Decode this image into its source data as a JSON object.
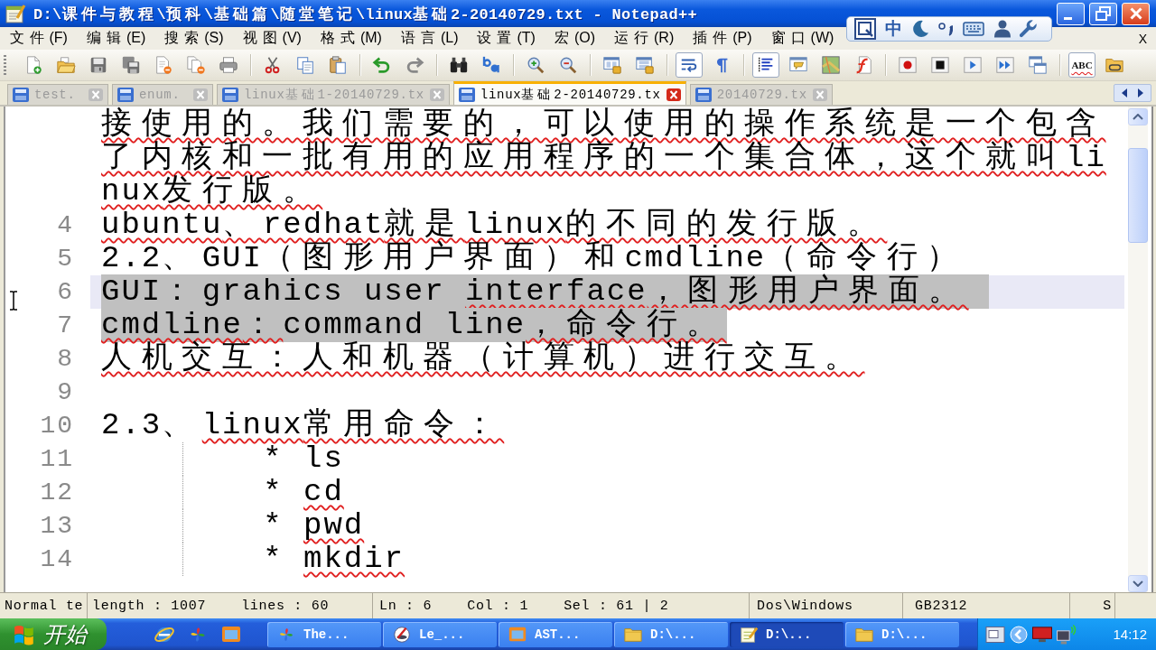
{
  "window": {
    "title": "D:\\课件与教程\\预科\\基础篇\\随堂笔记\\linux基础2-20140729.txt - Notepad++"
  },
  "menu": [
    "文件(F)",
    "编辑(E)",
    "搜索(S)",
    "视图(V)",
    "格式(M)",
    "语言(L)",
    "设置(T)",
    "宏(O)",
    "运行(R)",
    "插件(P)",
    "窗口(W)"
  ],
  "close_document": "X",
  "input_method_bar": {
    "mode": "中"
  },
  "toolbar": {
    "word_wrap": {
      "pressed": true
    },
    "show_all_characters": {
      "pressed": false
    },
    "indent_guide": {
      "pressed": true
    },
    "spell_check": {
      "label": "ABC",
      "pressed": true
    }
  },
  "tabs": [
    {
      "label": "test.",
      "selected": false
    },
    {
      "label": "enum.",
      "selected": false
    },
    {
      "label": "linux基础1-20140729.tx",
      "selected": false
    },
    {
      "label": "linux基础2-20140729.tx",
      "selected": true
    },
    {
      "label": "20140729.tx",
      "selected": false
    }
  ],
  "editor": {
    "lines": [
      {
        "selected": false,
        "current": false,
        "rows": [
          [
            {
              "text": "接使用的。我们需要的，可以使用的操作系统是一个包含",
              "misspelled": true
            }
          ],
          [
            {
              "text": "了内核和一批有用的应用程序的一个集合体，这个就叫li",
              "misspelled": true
            }
          ],
          [
            {
              "text": "nux发行版。",
              "misspelled": true
            }
          ]
        ]
      },
      {
        "number": "4",
        "selected": false,
        "current": false,
        "rows": [
          [
            {
              "text": "ubuntu、redhat就是linux的不同的发行版。",
              "misspelled": true
            }
          ]
        ]
      },
      {
        "number": "5",
        "selected": false,
        "current": false,
        "rows": [
          [
            {
              "text": "2.2、GUI（图形用户界面）和cmdline（命令行）",
              "misspelled": false
            }
          ]
        ]
      },
      {
        "number": "6",
        "selected": true,
        "current": true,
        "rows": [
          [
            {
              "text": "GUI：grahics user ",
              "misspelled": false
            },
            {
              "text": "interface，图形用户界面。",
              "misspelled": true
            }
          ]
        ]
      },
      {
        "number": "7",
        "selected": true,
        "current": false,
        "rows": [
          [
            {
              "text": "cmdline：",
              "misspelled": true
            },
            {
              "text": "command line",
              "misspelled": false
            },
            {
              "text": "，命令行。",
              "misspelled": true
            }
          ]
        ]
      },
      {
        "number": "8",
        "selected": false,
        "current": false,
        "rows": [
          [
            {
              "text": "人机交互：人和机器（计算机）进行交互。",
              "misspelled": true
            }
          ]
        ]
      },
      {
        "number": "9",
        "selected": false,
        "current": false
      },
      {
        "number": "10",
        "selected": false,
        "current": false,
        "rows": [
          [
            {
              "text": "2.3、",
              "misspelled": false
            },
            {
              "text": "linux常用命令：",
              "misspelled": true
            }
          ]
        ]
      },
      {
        "number": "11",
        "selected": false,
        "current": false,
        "rows": [
          [
            {
              "text": "\t\t* ls",
              "misspelled": false
            }
          ]
        ]
      },
      {
        "number": "12",
        "selected": false,
        "current": false,
        "rows": [
          [
            {
              "text": "\t\t* ",
              "misspelled": false
            },
            {
              "text": "cd",
              "misspelled": true
            }
          ]
        ]
      },
      {
        "number": "13",
        "selected": false,
        "current": false,
        "rows": [
          [
            {
              "text": "\t\t* ",
              "misspelled": false
            },
            {
              "text": "pwd",
              "misspelled": true
            }
          ]
        ]
      },
      {
        "number": "14",
        "selected": false,
        "current": false,
        "rows": [
          [
            {
              "text": "\t\t* ",
              "misspelled": false
            },
            {
              "text": "mkdir",
              "misspelled": true
            }
          ]
        ]
      }
    ]
  },
  "status_bar": {
    "document_type": "Normal te",
    "length": "length : 1007",
    "lines": "lines : 60",
    "line": "Ln : 6",
    "column": "Col : 1",
    "selection": "Sel : 61 | 2",
    "eol_format": "Dos\\Windows",
    "encoding": "GB2312",
    "cell_7": "S"
  },
  "taskbar": {
    "start": "开始",
    "tasks": [
      {
        "label": "The...",
        "selected": false
      },
      {
        "label": "Le_...",
        "selected": false
      },
      {
        "label": "AST...",
        "selected": false
      },
      {
        "label": "D:\\...",
        "selected": false
      },
      {
        "label": "D:\\...",
        "selected": true
      },
      {
        "label": "D:\\...",
        "selected": false
      }
    ],
    "clock": "14:12"
  }
}
